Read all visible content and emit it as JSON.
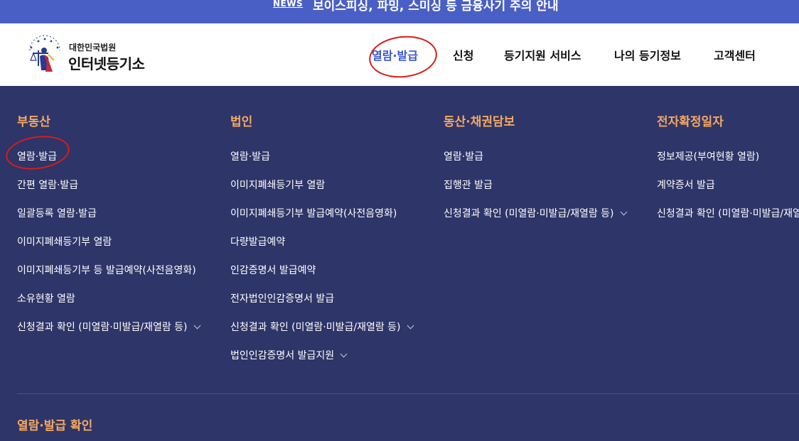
{
  "news": {
    "tag": "NEWS",
    "text": "보이스피싱, 파밍, 스미싱 등 금융사기 주의 안내"
  },
  "logo": {
    "org": "대한민국법원",
    "name": "인터넷등기소"
  },
  "nav": [
    {
      "label": "열람·발급",
      "active": true
    },
    {
      "label": "신청",
      "active": false
    },
    {
      "label": "등기지원 서비스",
      "active": false
    },
    {
      "label": "나의 등기정보",
      "active": false
    },
    {
      "label": "고객센터",
      "active": false
    }
  ],
  "menu": {
    "columns": [
      {
        "title": "부동산",
        "items": [
          "열람·발급",
          "간편 열람·발급",
          "일괄등록 열람·발급",
          "이미지폐쇄등기부 열람",
          "이미지폐쇄등기부 등 발급예약(사전음영화)",
          "소유현황 열람",
          "신청결과 확인 (미열람·미발급/재열람 등)"
        ]
      },
      {
        "title": "법인",
        "items": [
          "열람·발급",
          "이미지폐쇄등기부 열람",
          "이미지폐쇄등기부 발급예약(사전음영화)",
          "다량발급예약",
          "인감증명서 발급예약",
          "전자법인인감증명서 발급",
          "신청결과 확인 (미열람·미발급/재열람 등)",
          "법인인감증명서 발급지원"
        ]
      },
      {
        "title": "동산·채권담보",
        "items": [
          "열람·발급",
          "집행관 발급",
          "신청결과 확인 (미열람·미발급/재열람 등)"
        ]
      },
      {
        "title": "전자확정일자",
        "items": [
          "정보제공(부여현황 열람)",
          "계약증서 발급",
          "신청결과 확인 (미열람·미발급/재열람/미"
        ]
      }
    ],
    "bottom_title": "열람·발급 확인"
  },
  "colors": {
    "news_bg": "#4a5fc5",
    "menu_bg": "#2e3568",
    "section_title": "#f5a860",
    "active_nav": "#3a56d8",
    "annotation": "#d81c1c"
  }
}
